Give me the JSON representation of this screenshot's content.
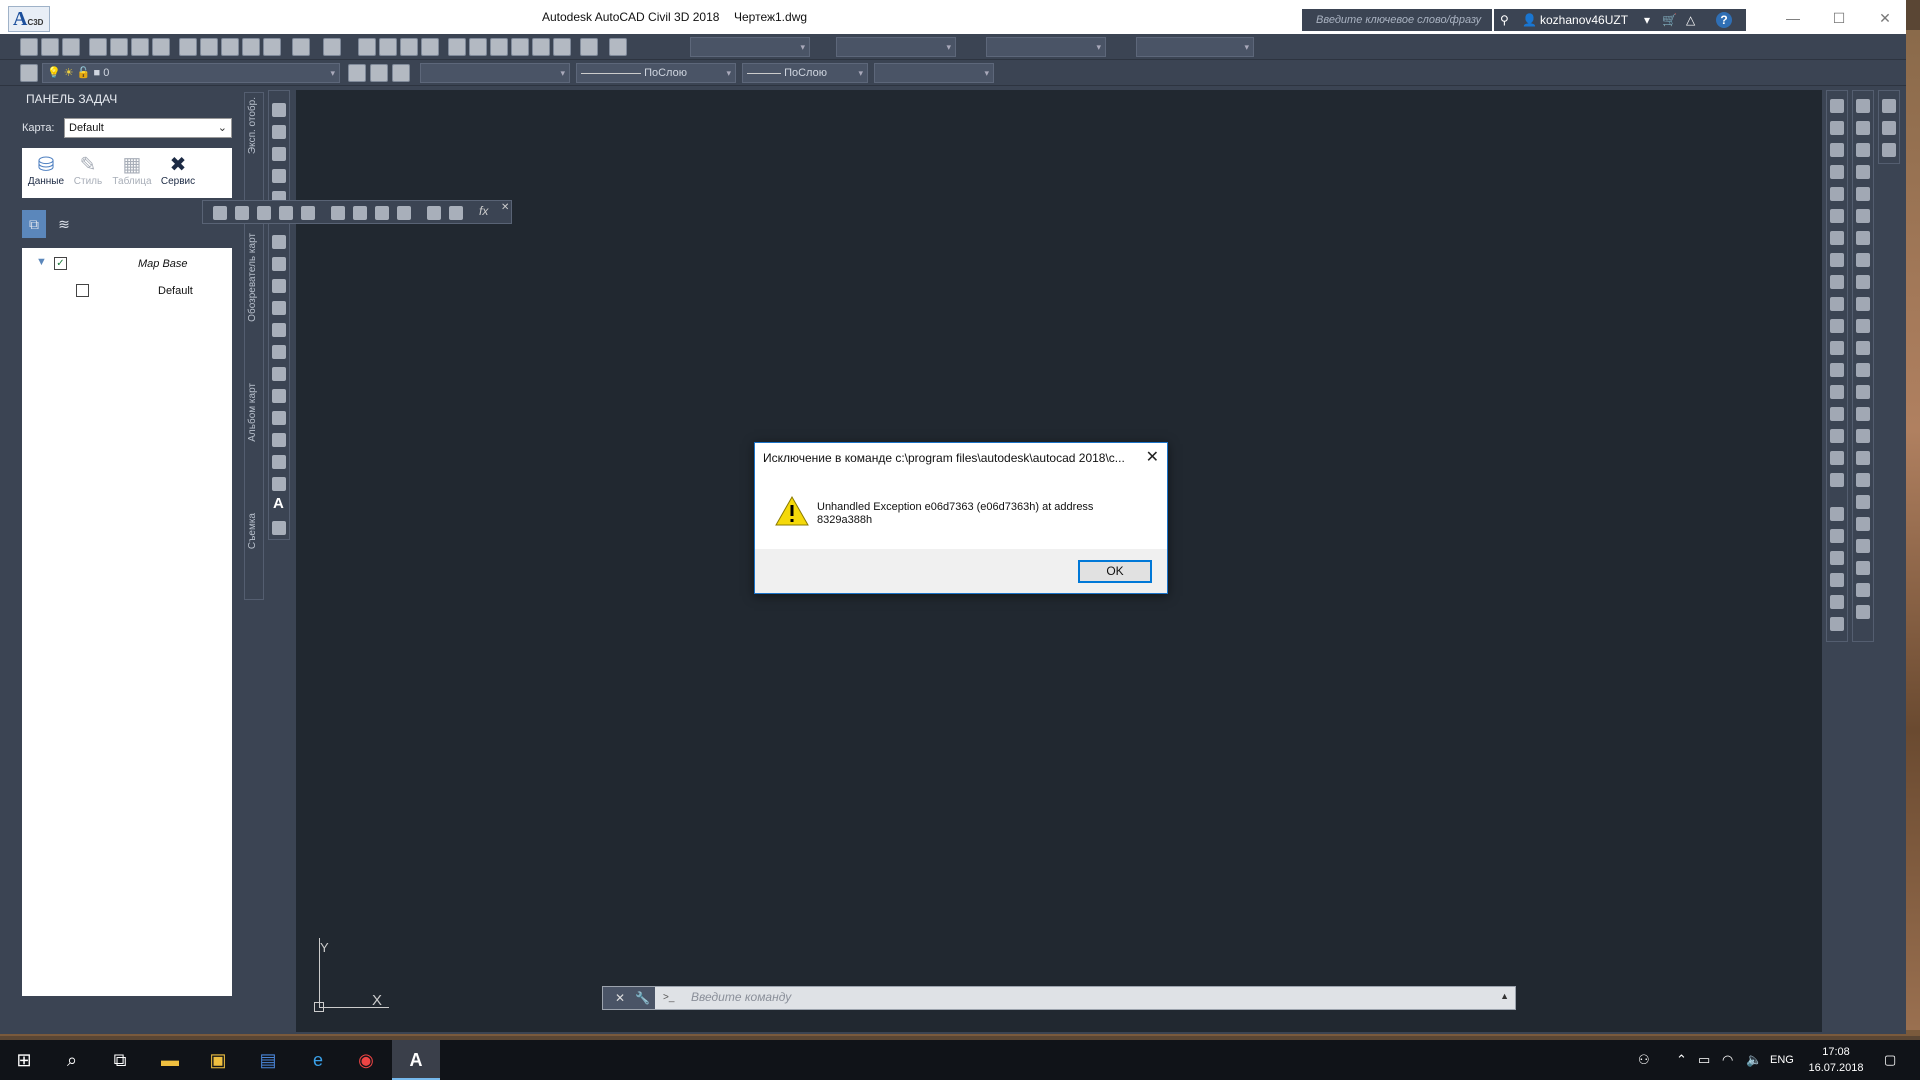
{
  "window": {
    "app_title": "Autodesk AutoCAD Civil 3D 2018",
    "document": "Чертеж1.dwg",
    "logo_letter": "A",
    "logo_sub": "C3D"
  },
  "infocenter": {
    "search_placeholder": "Введите ключевое слово/фразу",
    "user": "kozhanov46UZT",
    "help": "?"
  },
  "toolbar2": {
    "layer_value": "0",
    "linetype": "ПоСлою",
    "lineweight": "ПоСлою"
  },
  "taskpane": {
    "title": "ПАНЕЛЬ ЗАДАЧ",
    "map_label": "Карта:",
    "map_value": "Default",
    "tools": [
      {
        "label": "Данные",
        "active": true
      },
      {
        "label": "Стиль",
        "active": false
      },
      {
        "label": "Таблица",
        "active": false
      },
      {
        "label": "Сервис",
        "active": true
      }
    ],
    "tree": {
      "root": "Map Base",
      "child": "Default"
    }
  },
  "side_tabs": [
    "Эксп. отобр.",
    "Обозреватель карт",
    "Альбом карт",
    "Съемка"
  ],
  "float_toolbar": {
    "fx": "fx"
  },
  "drawing": {
    "ucs_x": "X",
    "ucs_y": "Y",
    "draw_text_tool": "A"
  },
  "command_line": {
    "placeholder": "Введите команду"
  },
  "dialog": {
    "title": "Исключение в команде c:\\program files\\autodesk\\autocad 2018\\c...",
    "message": "Unhandled Exception e06d7363 (e06d7363h) at address 8329a388h",
    "ok": "OK"
  },
  "taskbar": {
    "language": "ENG",
    "time": "17:08",
    "date": "16.07.2018"
  }
}
